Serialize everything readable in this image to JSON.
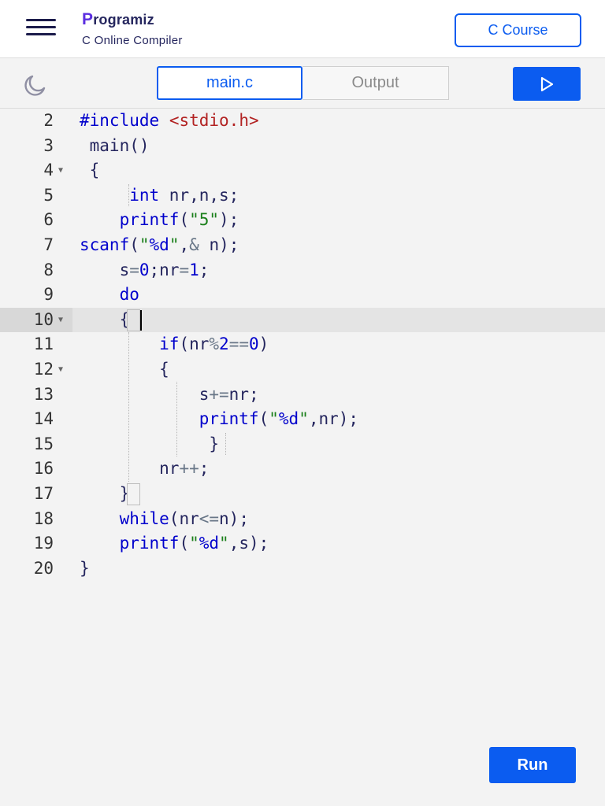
{
  "header": {
    "logo_first": "P",
    "logo_rest": "rogramiz",
    "subtitle": "C Online Compiler",
    "course_button": "C Course"
  },
  "toolbar": {
    "theme_icon": "moon-icon",
    "tab_main": "main.c",
    "tab_output": "Output",
    "run_icon": "play-icon"
  },
  "editor": {
    "active_line": 10,
    "lines": [
      {
        "num": "2",
        "text": "#include <stdio.h>"
      },
      {
        "num": "3",
        "text": " main()"
      },
      {
        "num": "4",
        "text": " {",
        "fold": true
      },
      {
        "num": "5",
        "text": "     int nr,n,s;"
      },
      {
        "num": "6",
        "text": "    printf(\"5\");"
      },
      {
        "num": "7",
        "text": "scanf(\"%d\",& n);"
      },
      {
        "num": "8",
        "text": "    s=0;nr=1;"
      },
      {
        "num": "9",
        "text": "    do"
      },
      {
        "num": "10",
        "text": "    {",
        "fold": true
      },
      {
        "num": "11",
        "text": "        if(nr%2==0)"
      },
      {
        "num": "12",
        "text": "        {",
        "fold": true
      },
      {
        "num": "13",
        "text": "            s+=nr;"
      },
      {
        "num": "14",
        "text": "            printf(\"%d\",nr);"
      },
      {
        "num": "15",
        "text": "             }"
      },
      {
        "num": "16",
        "text": "        nr++;"
      },
      {
        "num": "17",
        "text": "    }"
      },
      {
        "num": "18",
        "text": "    while(nr<=n);"
      },
      {
        "num": "19",
        "text": "    printf(\"%d\",s);"
      },
      {
        "num": "20",
        "text": "}"
      }
    ]
  },
  "run_button": "Run",
  "colors": {
    "accent": "#0b5cf0",
    "keyword": "#0000cc",
    "string": "#1a7f1a",
    "include_header": "#b22222",
    "text": "#25265e"
  }
}
